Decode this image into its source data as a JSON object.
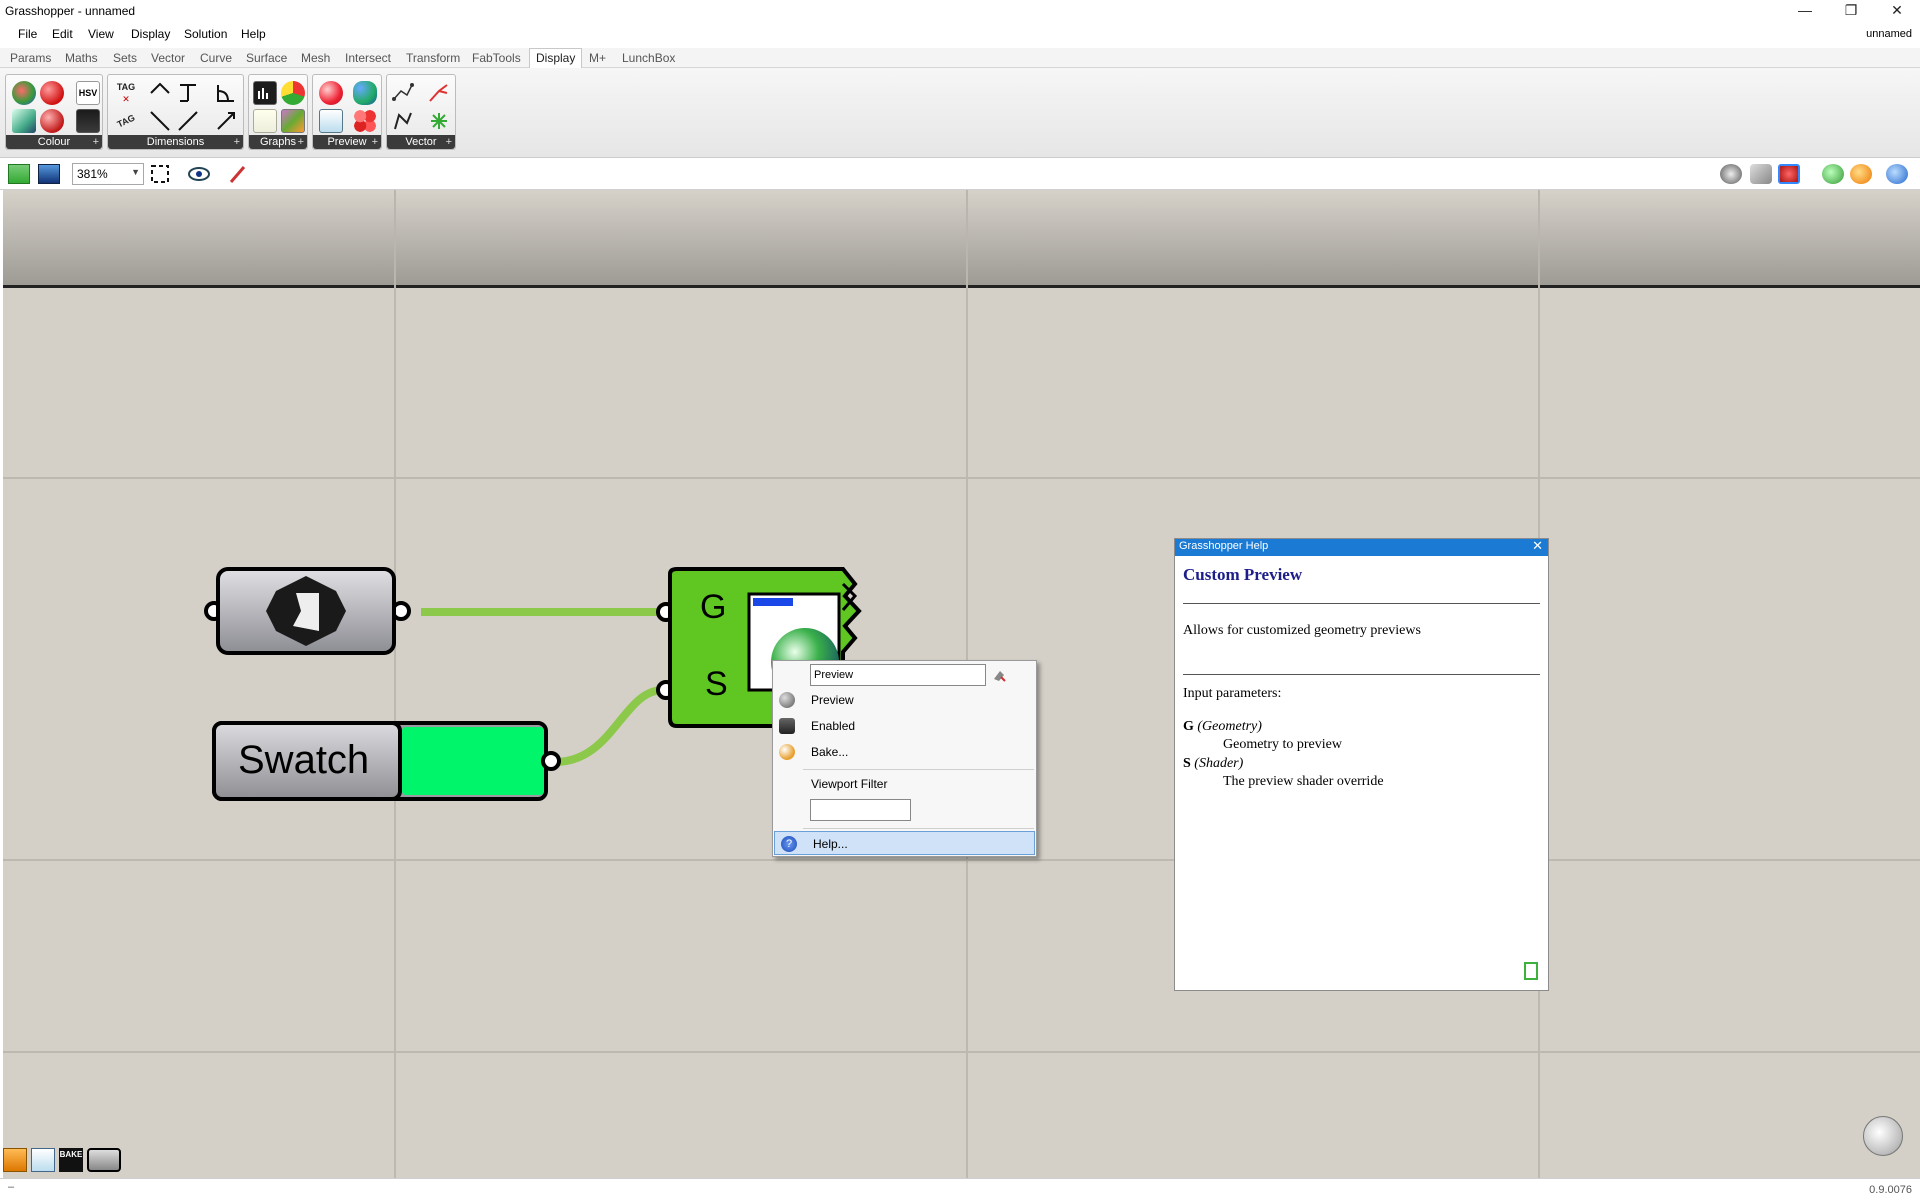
{
  "window": {
    "title": "Grasshopper - unnamed",
    "minimize_glyph": "—",
    "restore_glyph": "❐",
    "close_glyph": "✕"
  },
  "menubar": {
    "items": [
      "File",
      "Edit",
      "View",
      "Display",
      "Solution",
      "Help"
    ],
    "document_name": "unnamed"
  },
  "ribbon_tabs": {
    "items": [
      "Params",
      "Maths",
      "Sets",
      "Vector",
      "Curve",
      "Surface",
      "Mesh",
      "Intersect",
      "Transform",
      "FabTools",
      "Display",
      "M+",
      "LunchBox"
    ],
    "active": "Display"
  },
  "ribbon_groups": {
    "colour": "Colour",
    "dimensions": "Dimensions",
    "graphs": "Graphs",
    "preview": "Preview",
    "vector": "Vector",
    "hsv_icon_text": "HSV",
    "tag_icon_text": "TAG",
    "bake_icon_text": "BAKE",
    "group_plus": "+"
  },
  "canvas_toolbar": {
    "zoom": "381%",
    "zoom_dropdown_glyph": "▼"
  },
  "canvas": {
    "swatch_label": "Swatch",
    "swatch_color": "#00f56a",
    "component_color": "#5fc622",
    "input_g": "G",
    "input_s": "S"
  },
  "context_menu": {
    "name_value": "Preview",
    "items": {
      "preview": "Preview",
      "enabled": "Enabled",
      "bake": "Bake...",
      "viewport_filter": "Viewport Filter",
      "help": "Help..."
    },
    "filter_value": ""
  },
  "help_window": {
    "titlebar": "Grasshopper Help",
    "close_glyph": "✕",
    "heading": "Custom Preview",
    "description": "Allows for customized geometry previews",
    "inputs_heading": "Input parameters:",
    "params": [
      {
        "code": "G",
        "type": "(Geometry)",
        "desc": "Geometry to preview"
      },
      {
        "code": "S",
        "type": "(Shader)",
        "desc": "The preview shader override"
      }
    ]
  },
  "status": {
    "version": "0.9.0076",
    "left_text": "–"
  },
  "colors": {
    "accent_blue": "#1a7ad4",
    "help_heading": "#1e1e8a",
    "canvas_bg": "#d4d0c8"
  }
}
